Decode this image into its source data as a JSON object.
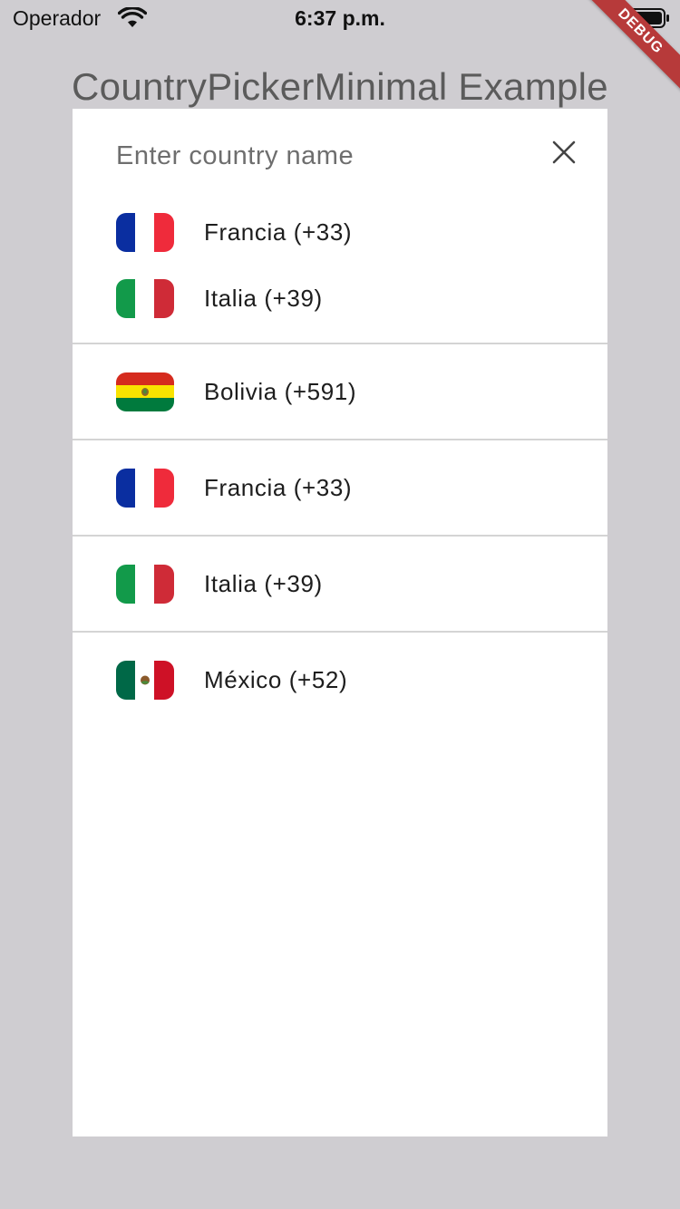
{
  "status_bar": {
    "carrier": "Operador",
    "time": "6:37 p.m."
  },
  "debug_banner": "DEBUG",
  "app_title": "CountryPickerMinimal Example",
  "dialog": {
    "search_placeholder": "Enter country name",
    "favorites": [
      {
        "flag": "fr-flag",
        "label": "Francia (+33)"
      },
      {
        "flag": "it-flag",
        "label": "Italia (+39)"
      }
    ],
    "countries": [
      {
        "flag": "bo-flag",
        "label": "Bolivia (+591)"
      },
      {
        "flag": "fr-flag",
        "label": "Francia (+33)"
      },
      {
        "flag": "it-flag",
        "label": "Italia (+39)"
      },
      {
        "flag": "mx-flag",
        "label": "México (+52)"
      }
    ]
  },
  "colors": {
    "background": "#cfcdd1",
    "debug_ribbon": "#b73a3a",
    "france_blue": "#0a2ea0",
    "france_red": "#ef2b3b",
    "italy_green": "#129a4a",
    "italy_red": "#cf2b37",
    "bolivia_red": "#d52b1e",
    "bolivia_yellow": "#f9e300",
    "bolivia_green": "#007a3d",
    "mexico_green": "#006847",
    "mexico_red": "#ce1126"
  }
}
